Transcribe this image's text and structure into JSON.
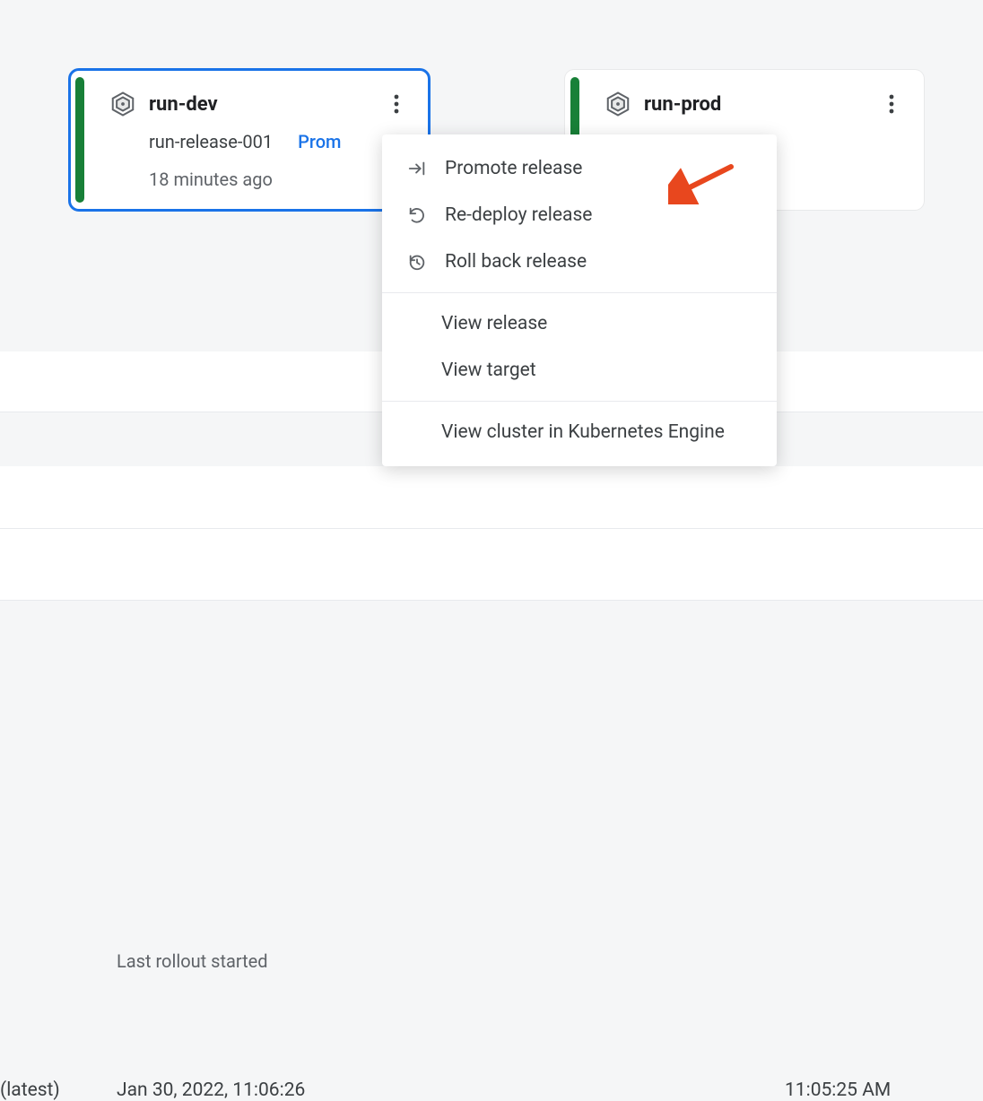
{
  "cards": {
    "dev": {
      "title": "run-dev",
      "release": "run-release-001",
      "promote_link": "Prom",
      "time": "18 minutes ago"
    },
    "prod": {
      "title": "run-prod"
    }
  },
  "menu": {
    "promote": "Promote release",
    "redeploy": "Re-deploy release",
    "rollback": "Roll back release",
    "view_release": "View release",
    "view_target": "View target",
    "view_cluster": "View cluster in Kubernetes Engine"
  },
  "table": {
    "header_last_rollout": "Last rollout started",
    "latest_label": "(latest)",
    "time_left": "Jan 30, 2022, 11:06:26",
    "time_right": "11:05:25 AM"
  },
  "colors": {
    "accent": "#1a73e8",
    "success": "#188038",
    "arrow": "#e8471e"
  }
}
